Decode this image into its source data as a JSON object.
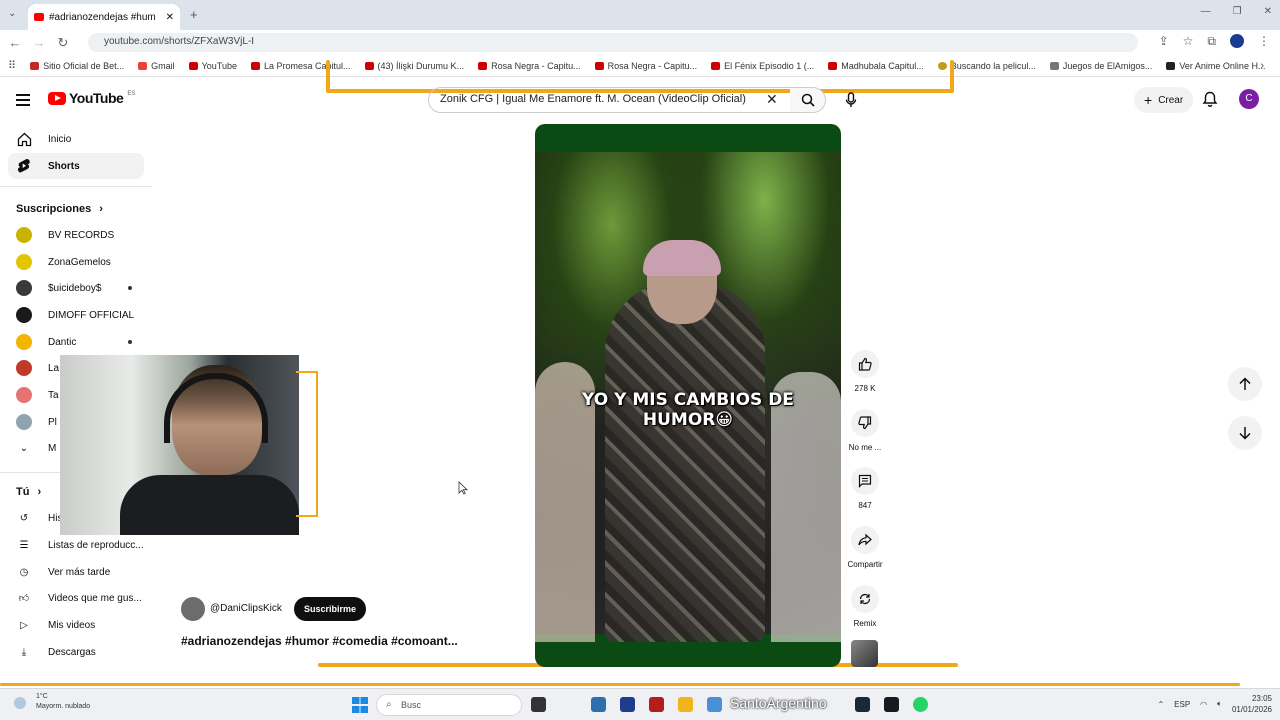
{
  "browser": {
    "tab_title": "#adrianozendejas #hum",
    "address": "youtube.com/shorts/ZFXaW3VjL-I",
    "bookmarks": [
      "Sitio Oficial de Bet...",
      "Gmail",
      "YouTube",
      "La Promesa Capitul...",
      "(43) İlişki Durumu K...",
      "Rosa Negra - Capitu...",
      "Rosa Negra - Capitu...",
      "El Fénix Episodio 1 (...",
      "Madhubala Capitul...",
      "Buscando la pelicul...",
      "Juegos de ElAmigos...",
      "Ver Anime Online H..."
    ]
  },
  "masthead": {
    "logo": "YouTube",
    "logo_country": "ES",
    "search_value": "Zonik CFG | Igual Me Enamore ft. M. Ocean (VideoClip Oficial)",
    "create_label": "Crear",
    "avatar_letter": "C"
  },
  "sidebar": {
    "items": [
      {
        "label": "Inicio",
        "icon": "home-icon"
      },
      {
        "label": "Shorts",
        "icon": "shorts-icon"
      }
    ],
    "subscriptions_header": "Suscripciones",
    "subscriptions": [
      {
        "label": "BV RECORDS",
        "color": "#c8b400",
        "dot": false
      },
      {
        "label": "ZonaGemelos",
        "color": "#e2c600",
        "dot": false
      },
      {
        "label": "$uicideboy$",
        "color": "#3a3a3a",
        "dot": true
      },
      {
        "label": "DIMOFF OFFICIAL",
        "color": "#1a1a1a",
        "dot": false
      },
      {
        "label": "Dantic",
        "color": "#f4b400",
        "dot": true
      },
      {
        "label": "La",
        "color": "#c0392b",
        "dot": false
      },
      {
        "label": "Ta",
        "color": "#e57373",
        "dot": false
      },
      {
        "label": "Pl",
        "color": "#90a4ae",
        "dot": false
      },
      {
        "label": "M",
        "color": "#555555",
        "dot": false
      }
    ],
    "you_header": "Tú",
    "you_items": [
      {
        "label": "His",
        "icon": "history-icon"
      },
      {
        "label": "Listas de reproducc...",
        "icon": "playlist-icon"
      },
      {
        "label": "Ver más tarde",
        "icon": "clock-icon"
      },
      {
        "label": "Videos que me gus...",
        "icon": "like-icon"
      },
      {
        "label": "Mis videos",
        "icon": "my-videos-icon"
      },
      {
        "label": "Descargas",
        "icon": "download-icon"
      }
    ]
  },
  "short": {
    "caption_line1": "YO Y MIS CAMBIOS DE",
    "caption_line2": "HUMOR😀",
    "channel": "@DaniClipsKick",
    "subscribe_label": "Suscribirme",
    "title": "#adrianozendejas #humor #comedia #comoant...",
    "actions": {
      "likes": "278 K",
      "dislike_label": "No me ...",
      "comments": "847",
      "share_label": "Compartir",
      "remix_label": "Remix"
    }
  },
  "taskbar": {
    "weather_temp": "1°C",
    "weather_desc": "Mayorm. nublado",
    "search_placeholder": "Busc",
    "watermark": "SantoArgentino",
    "lang": "ESP",
    "time": "23:05",
    "date": "01/01/2026"
  },
  "colors": {
    "accent": "#f0a818",
    "yt_red": "#ff0000",
    "player_bg": "#0b4a12"
  }
}
